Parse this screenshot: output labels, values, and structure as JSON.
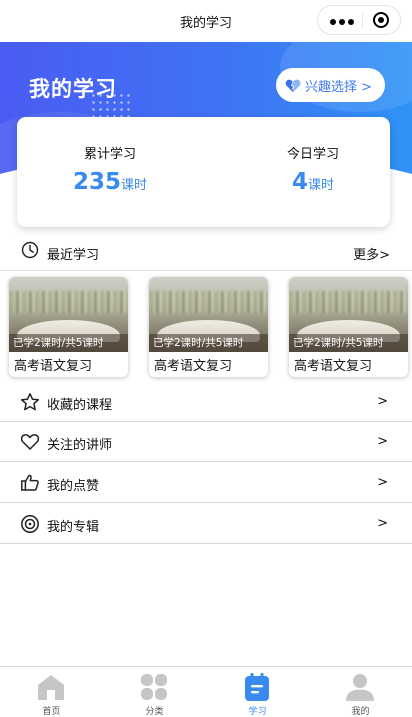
{
  "nav": {
    "title": "我的学习"
  },
  "header": {
    "title": "我的学习",
    "interest_button": "兴趣选择 >"
  },
  "stats": {
    "total_label": "累计学习",
    "total_value": "235",
    "today_label": "今日学习",
    "today_value": "4",
    "unit": "课时"
  },
  "recent": {
    "title": "最近学习",
    "more": "更多>",
    "courses": [
      {
        "progress": "已学2课时/共5课时",
        "name": "高考语文复习"
      },
      {
        "progress": "已学2课时/共5课时",
        "name": "高考语文复习"
      },
      {
        "progress": "已学2课时/共5课时",
        "name": "高考语文复习"
      }
    ]
  },
  "menu": {
    "items": [
      {
        "label": "收藏的课程",
        "arrow": ">",
        "icon": "star-icon"
      },
      {
        "label": "关注的讲师",
        "arrow": ">",
        "icon": "heart-icon"
      },
      {
        "label": "我的点赞",
        "arrow": ">",
        "icon": "thumbs-up-icon"
      },
      {
        "label": "我的专辑",
        "arrow": ">",
        "icon": "album-icon"
      }
    ]
  },
  "tabbar": {
    "tabs": [
      {
        "label": "首页",
        "icon": "home-icon",
        "active": false
      },
      {
        "label": "分类",
        "icon": "category-icon",
        "active": false
      },
      {
        "label": "学习",
        "icon": "study-icon",
        "active": true
      },
      {
        "label": "我的",
        "icon": "user-icon",
        "active": false
      }
    ]
  },
  "colors": {
    "accent": "#3a89ef",
    "header_start": "#4a5cf2",
    "header_end": "#2f93f6",
    "inactive_icon": "#c6c6c6"
  }
}
